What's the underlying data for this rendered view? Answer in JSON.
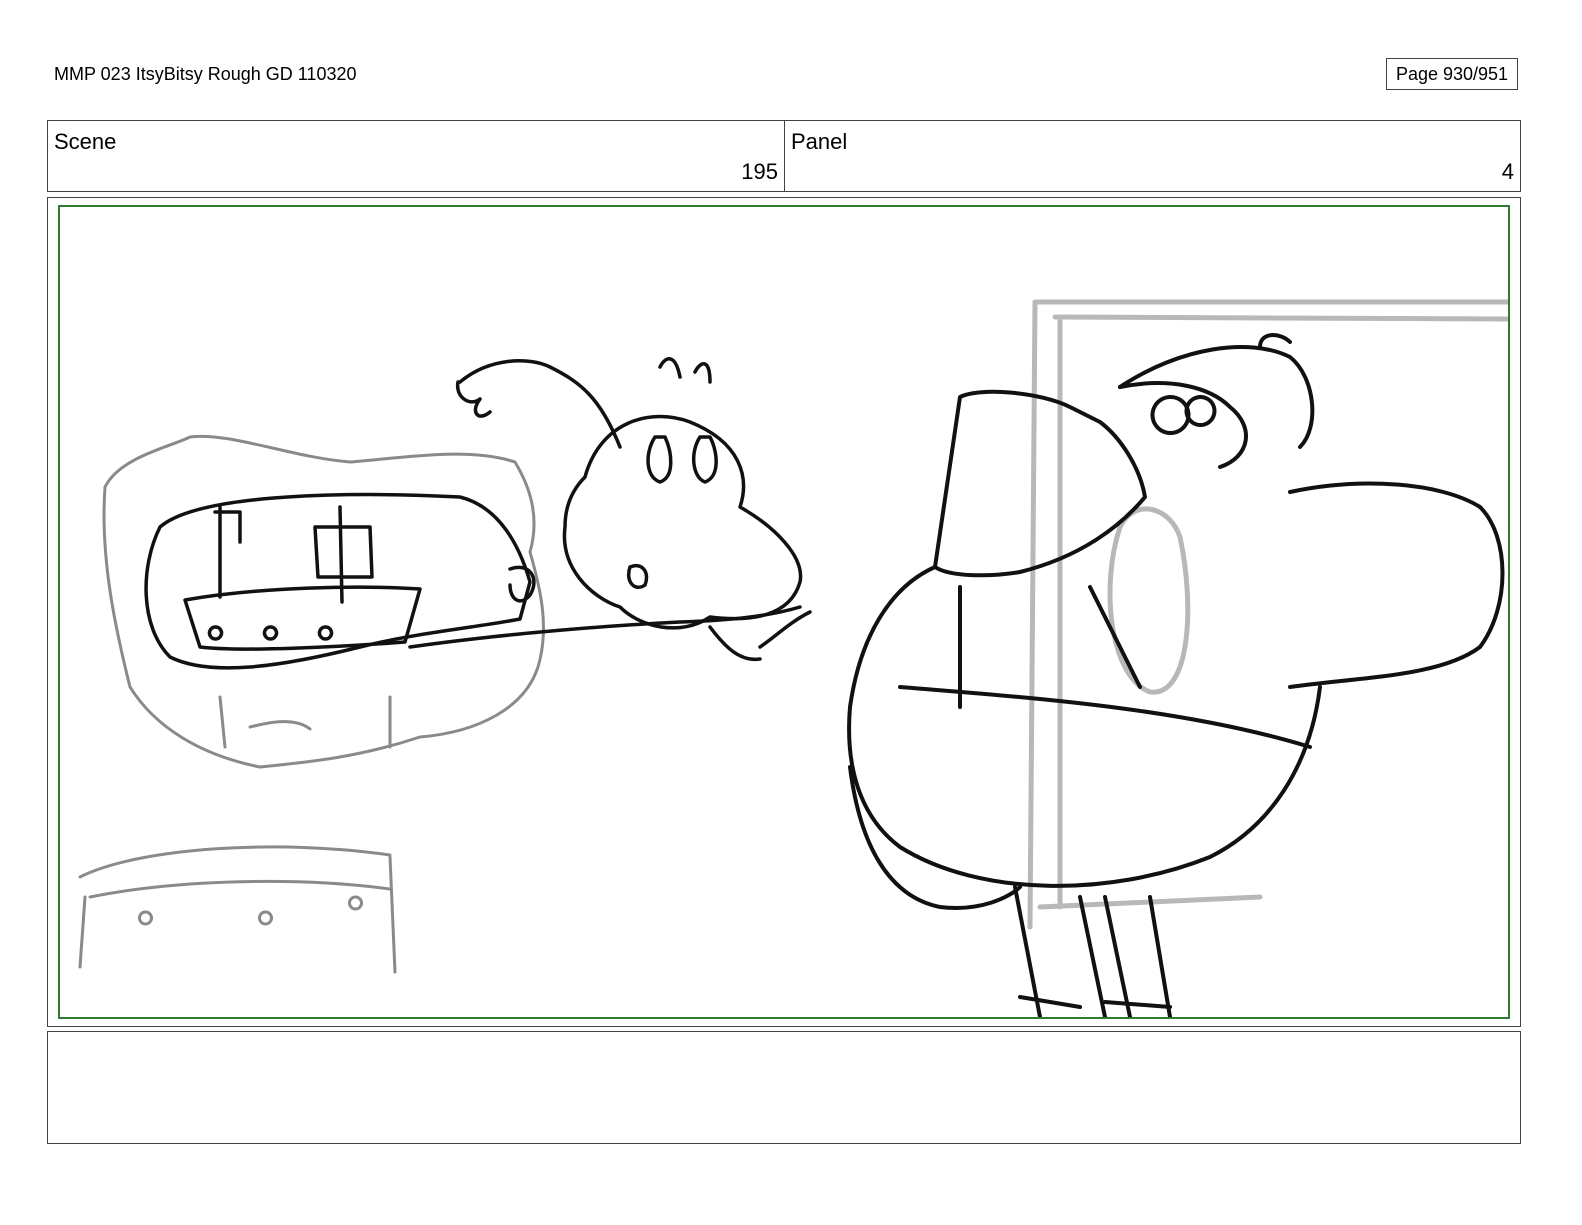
{
  "document": {
    "title": "MMP 023 ItsyBitsy Rough GD 110320",
    "page": "Page 930/951"
  },
  "header": {
    "scene_label": "Scene",
    "scene_value": "195",
    "panel_label": "Panel",
    "panel_value": "4"
  },
  "frame": {
    "border_color": "#2f7a2f",
    "sketch": "rough pencil storyboard drawing"
  },
  "notes": {
    "text": ""
  }
}
